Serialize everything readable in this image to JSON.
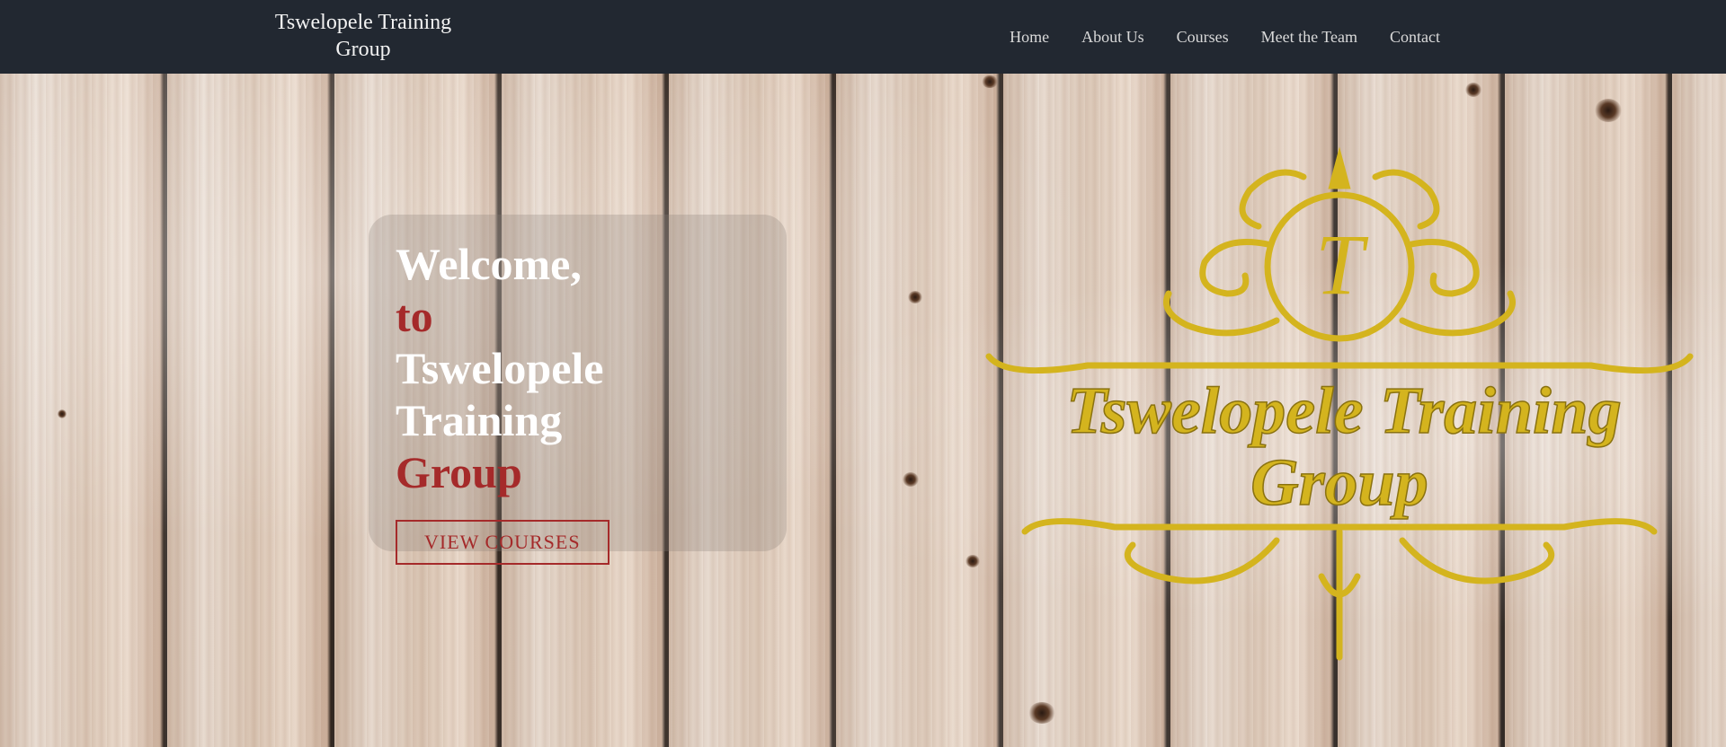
{
  "header": {
    "brand": "Tswelopele Training Group",
    "nav": [
      {
        "label": "Home"
      },
      {
        "label": "About Us"
      },
      {
        "label": "Courses"
      },
      {
        "label": "Meet the Team"
      },
      {
        "label": "Contact"
      }
    ]
  },
  "hero": {
    "heading_lines": [
      "Welcome,",
      "to",
      "Tswelopele Training",
      "Group"
    ],
    "cta_label": "VIEW COURSES"
  },
  "logo": {
    "monogram": "T",
    "text_line1": "Tswelopele Training",
    "text_line2": "Group",
    "color": "#d4b41e"
  },
  "colors": {
    "navbar": "#222831",
    "accent": "#a52a2a",
    "heading": "#ffffff"
  }
}
